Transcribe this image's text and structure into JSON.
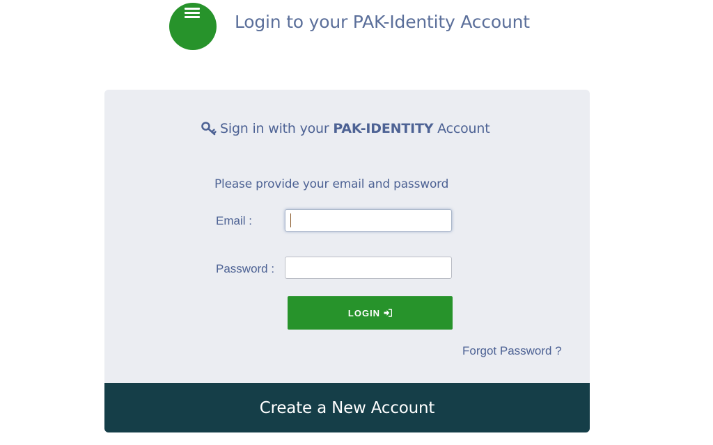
{
  "header": {
    "title": "Login to your PAK-Identity Account",
    "logo_icon": "menu-lines-icon",
    "logo_color": "#27932b"
  },
  "card": {
    "heading_icon": "key-icon",
    "heading_prefix": "Sign in with your",
    "heading_brand": "PAK-IDENTITY",
    "heading_suffix": "Account",
    "instructions": "Please provide your email and password",
    "email_label": "Email :",
    "email_value": "",
    "password_label": "Password :",
    "password_value": "",
    "login_label": "LOGIN",
    "login_icon": "sign-in-icon",
    "forgot_label": "Forgot Password ?",
    "create_label": "Create a New Account"
  },
  "colors": {
    "accent_green": "#27932b",
    "text_blue": "#4d6294",
    "card_background": "#ebedf2",
    "footer_bar": "#153e48"
  }
}
